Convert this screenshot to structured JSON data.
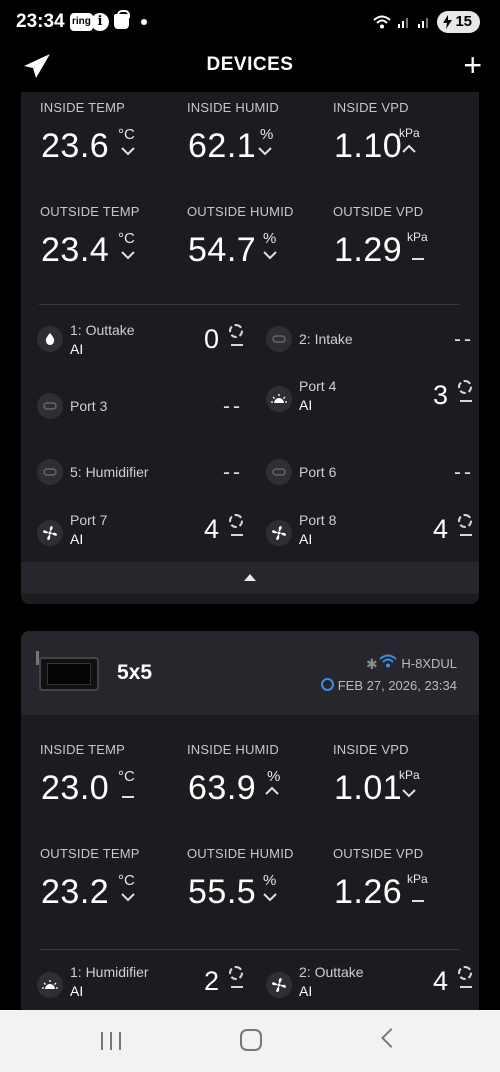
{
  "status_bar": {
    "time": "23:34",
    "app_badge": "ring",
    "battery": "15"
  },
  "header": {
    "title": "DEVICES",
    "add_icon": "plus-icon",
    "logo_icon": "paper-plane-logo"
  },
  "labels": {
    "inside_temp": "INSIDE TEMP",
    "inside_humid": "INSIDE HUMID",
    "inside_vpd": "INSIDE VPD",
    "outside_temp": "OUTSIDE TEMP",
    "outside_humid": "OUTSIDE HUMID",
    "outside_vpd": "OUTSIDE VPD",
    "unit_temp": "°C",
    "unit_humid": "%",
    "unit_vpd": "kPa"
  },
  "device1": {
    "inside_temp": "23.6",
    "inside_temp_trend": "down",
    "inside_humid": "62.1",
    "inside_humid_trend": "down",
    "inside_vpd": "1.10",
    "inside_vpd_trend": "up",
    "outside_temp": "23.4",
    "outside_temp_trend": "down",
    "outside_humid": "54.7",
    "outside_humid_trend": "down",
    "outside_vpd": "1.29",
    "outside_vpd_trend": "flat",
    "ports": [
      {
        "name": "1: Outtake",
        "mode": "AI",
        "value": "0",
        "icon": "water-drop-icon"
      },
      {
        "name": "2: Intake",
        "mode": "",
        "value": "--",
        "icon": "disconnected-icon"
      },
      {
        "name": "Port 3",
        "mode": "",
        "value": "--",
        "icon": "disconnected-icon"
      },
      {
        "name": "Port 4",
        "mode": "AI",
        "value": "3",
        "icon": "grow-light-icon"
      },
      {
        "name": "5: Humidifier",
        "mode": "",
        "value": "--",
        "icon": "disconnected-icon"
      },
      {
        "name": "Port 6",
        "mode": "",
        "value": "--",
        "icon": "disconnected-icon"
      },
      {
        "name": "Port 7",
        "mode": "AI",
        "value": "4",
        "icon": "fan-icon"
      },
      {
        "name": "Port 8",
        "mode": "AI",
        "value": "4",
        "icon": "fan-icon"
      }
    ]
  },
  "device2": {
    "name": "5x5",
    "device_id": "H-8XDUL",
    "timestamp": "FEB 27, 2026, 23:34",
    "inside_temp": "23.0",
    "inside_temp_trend": "flat",
    "inside_humid": "63.9",
    "inside_humid_trend": "up",
    "inside_vpd": "1.01",
    "inside_vpd_trend": "down",
    "outside_temp": "23.2",
    "outside_temp_trend": "down",
    "outside_humid": "55.5",
    "outside_humid_trend": "down",
    "outside_vpd": "1.26",
    "outside_vpd_trend": "flat",
    "ports": [
      {
        "name": "1: Humidifier",
        "mode": "AI",
        "value": "2",
        "icon": "grow-light-icon"
      },
      {
        "name": "2: Outtake",
        "mode": "AI",
        "value": "4",
        "icon": "fan-icon"
      }
    ]
  }
}
